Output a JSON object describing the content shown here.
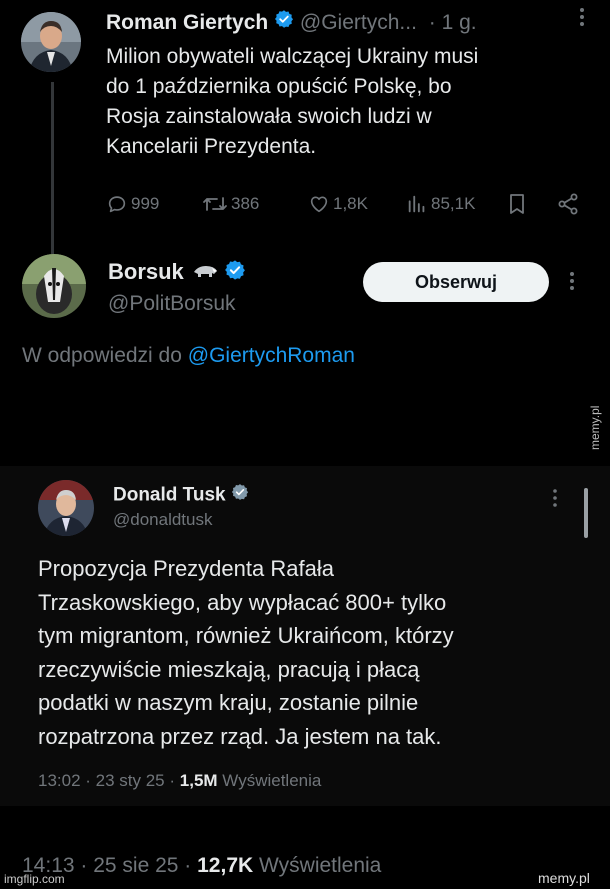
{
  "tweet1": {
    "name": "Roman Giertych",
    "handle": "@Giertych...",
    "time": "· 1 g.",
    "more_icon": "more-vertical-icon",
    "text": "Milion obywateli walczącej Ukrainy musi\ndo 1 października opuścić Polskę, bo\nRosja zainstalowała swoich ludzi w\nKancelarii Prezydenta.",
    "replies": "999",
    "reposts": "386",
    "likes": "1,8K",
    "views": "85,1K"
  },
  "tweet2": {
    "name": "Borsuk",
    "handle": "@PolitBorsuk",
    "follow_label": "Obserwuj",
    "reply_prefix": "W odpowiedzi do",
    "reply_mention": "@GiertychRoman"
  },
  "quoted": {
    "name": "Donald Tusk",
    "handle": "@donaldtusk",
    "text": "Propozycja Prezydenta Rafała\nTrzaskowskiego, aby wypłacać 800+ tylko\ntym migrantom, również Ukraińcom, którzy\nrzeczywiście mieszkają, pracują i płacą\npodatki w naszym kraju, zostanie pilnie\nrozpatrzona przez rząd. Ja jestem na tak.",
    "time": "13:02 · 23 sty 25 ·",
    "views_count": "1,5M",
    "views_label": "Wyświetlenia"
  },
  "footer": {
    "time": "14:13 · 25 sie 25 ·",
    "views_count": "12,7K",
    "views_label": "Wyświetlenia"
  },
  "watermarks": {
    "side": "memy.pl",
    "bottom_right": "memy.pl",
    "bottom_left": "imgflip.com"
  },
  "colors": {
    "background": "#000000",
    "text": "#e7e9ea",
    "secondary": "#71767b",
    "link": "#1d9bf0",
    "verified": "#1d9bf0"
  }
}
